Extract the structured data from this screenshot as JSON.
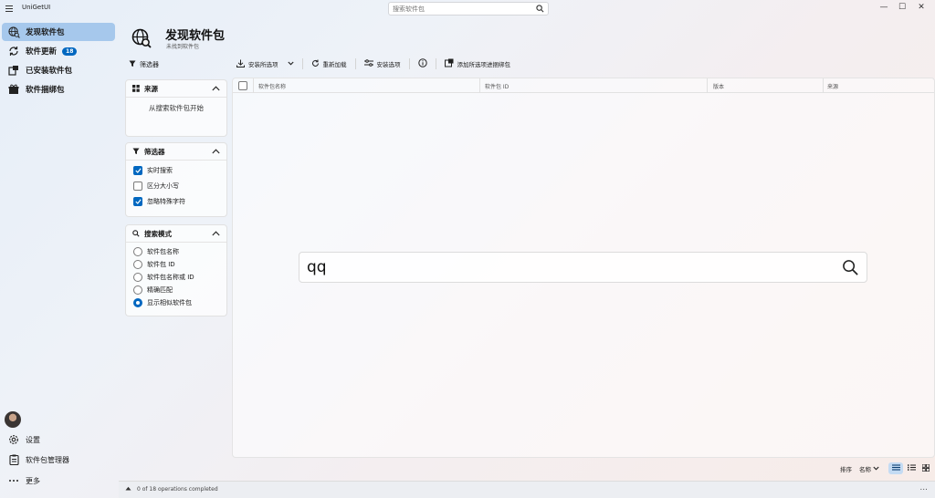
{
  "window": {
    "app_title": "UniGetUI",
    "search_placeholder": "搜索软件包",
    "minimize": "—",
    "maximize": "☐",
    "close": "✕"
  },
  "sidebar": {
    "items": [
      {
        "label": "发现软件包",
        "active": true
      },
      {
        "label": "软件更新",
        "badge": "18"
      },
      {
        "label": "已安装软件包"
      },
      {
        "label": "软件捆绑包"
      }
    ],
    "bottom": [
      {
        "label": "设置"
      },
      {
        "label": "软件包管理器"
      },
      {
        "label": "更多"
      }
    ]
  },
  "header": {
    "title": "发现软件包",
    "subtitle": "未找到软件包"
  },
  "toolbar": {
    "filters_label": "筛选器",
    "install_selected": "安装所选项",
    "reload": "重新加载",
    "install_options": "安装选项",
    "add_to_bundle": "添加所选项进捆绑包"
  },
  "panels": {
    "sources": {
      "title": "来源",
      "empty_text": "从搜索软件包开始"
    },
    "filters": {
      "title": "筛选器",
      "options": [
        {
          "label": "实时搜索",
          "checked": true
        },
        {
          "label": "区分大小写",
          "checked": false
        },
        {
          "label": "忽略特殊字符",
          "checked": true
        }
      ]
    },
    "search_mode": {
      "title": "搜索模式",
      "options": [
        {
          "label": "软件包名称",
          "selected": false
        },
        {
          "label": "软件包 ID",
          "selected": false
        },
        {
          "label": "软件包名称或 ID",
          "selected": false
        },
        {
          "label": "精确匹配",
          "selected": false
        },
        {
          "label": "显示相似软件包",
          "selected": true
        }
      ]
    }
  },
  "table": {
    "columns": [
      "软件包名称",
      "软件包 ID",
      "版本",
      "来源"
    ]
  },
  "main_search": {
    "value": "qq"
  },
  "sort": {
    "label": "排序",
    "value": "名称"
  },
  "status": {
    "text": "0 of 18 operations completed",
    "more": "..."
  },
  "colors": {
    "accent": "#0067c0",
    "active_nav": "#a6c8ec"
  }
}
